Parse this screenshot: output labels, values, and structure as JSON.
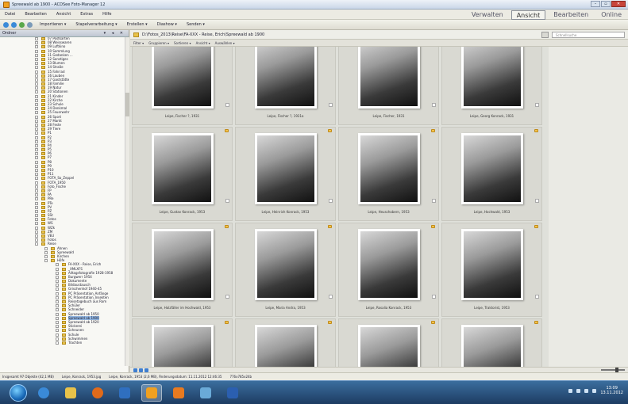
{
  "window": {
    "title": "Spreewald ab 1900 - ACDSee Foto-Manager 12",
    "controls": [
      "–",
      "▫",
      "✕"
    ]
  },
  "menu": [
    "Datei",
    "Bearbeiten",
    "Ansicht",
    "Extras",
    "Hilfe"
  ],
  "modes": {
    "items": [
      "Verwalten",
      "Ansicht",
      "Bearbeiten",
      "Online"
    ],
    "active": "Ansicht"
  },
  "toolbar": {
    "menus": [
      "Importieren ▾",
      "Stapelverarbeitung ▾",
      "Erstellen ▾",
      "Diashow ▾",
      "Senden ▾"
    ]
  },
  "folders_panel": {
    "title": "Ordner",
    "controls": "▾ ◂ ✕",
    "items": [
      "07 Postkarten",
      "08 Weisswaren",
      "09 Luftkino",
      "10 Sammlung",
      "11 Gedanken ...",
      "12 Sonstiges",
      "13 Blumen",
      "14 Straße",
      "15 Fahrrad",
      "16 Lauben",
      "17 Gaststätte",
      "18 Familie",
      "19 Natur",
      "20 Stationen",
      "21 Kinder",
      "22 Kirche",
      "23 Schule",
      "24 Denkmal",
      "25 Feuerwehr",
      "26 Sport",
      "27 Markt",
      "28 Feste",
      "29 Tiere",
      "P1",
      "P2",
      "P3",
      "P4",
      "P5",
      "P6",
      "P7",
      "P8",
      "P9",
      "P10",
      "P11",
      "FOTA_So_Zeppel",
      "FOTA_1950",
      "Foto_Fische",
      "FP",
      "PA",
      "PRe",
      "PTe",
      "PV",
      "PZ",
      "SSt",
      "Fotos",
      "WS",
      "WZk",
      "ZM",
      "VEU",
      "Fotos",
      "Reise",
      "Ahnen",
      "Spreewald",
      "Kirchen",
      "Höfe",
      "FA-XXX - Reise, Erich",
      "_XMLXFS",
      "Alltagsfotografie 1928-1958",
      "Burgwerr 1954",
      "Dokumente",
      "Bildaustausch",
      "Grischenhof 1940-45",
      "PC Präsentation_Anfänge",
      "PC Präsentation_Insekten",
      "Reisetagebuch aus Rom",
      "Schüler",
      "Schneider",
      "Spreewald ab 1950",
      "Spreewald ab 1900",
      "Spreewald ab 1920",
      "Stickerei",
      "Scheunen",
      "Schule",
      "Schwimmen",
      "Trachten"
    ],
    "selected": "Spreewald ab 1900"
  },
  "address": {
    "path": "D:\\Fotos_2013\\Reise\\FA-XXX - Reise, Erich\\Spreewald ab 1900",
    "search_placeholder": "Schnellsuche"
  },
  "filters": [
    "Filter ▾",
    "Gruppieren ▾",
    "Sortieren ▾",
    "Ansicht ▾",
    "Auswählen ▾"
  ],
  "photos": [
    {
      "caption": "Leipe, Fischer ?, 1931"
    },
    {
      "caption": "Leipe, Fischer ?, 1931a"
    },
    {
      "caption": "Leipe, Fischer, 1931"
    },
    {
      "caption": "Leipe, Georg Konrack, 1931"
    },
    {
      "caption": "Leipe, Gustav Konrack, 1953"
    },
    {
      "caption": "Leipe, Heinrich Konrack, 1953"
    },
    {
      "caption": "Leipe, Heuschobern, 1953"
    },
    {
      "caption": "Leipe, Hochwald, 1953"
    },
    {
      "caption": "Leipe, Holzfäller im Hochwald, 1953"
    },
    {
      "caption": "Leipe, Maria Andra, 1953"
    },
    {
      "caption": "Leipe, Rosalia Konrack, 1953"
    },
    {
      "caption": "Leipe, Traktorist, 1953"
    },
    {
      "caption": ""
    },
    {
      "caption": ""
    },
    {
      "caption": ""
    },
    {
      "caption": ""
    }
  ],
  "status": {
    "selection": "Insgesamt 97 Objekte (42,1 MB)",
    "file": "Leipe, Konrack, 1953.jpg",
    "details": "Leipe, Konrack, 1953 (2,6 MB), Änderungsdatum: 11.11.2012 12:46:35",
    "dimensions": "776x785x24b"
  },
  "taskbar": {
    "clock_time": "13:09",
    "clock_date": "13.11.2012"
  }
}
